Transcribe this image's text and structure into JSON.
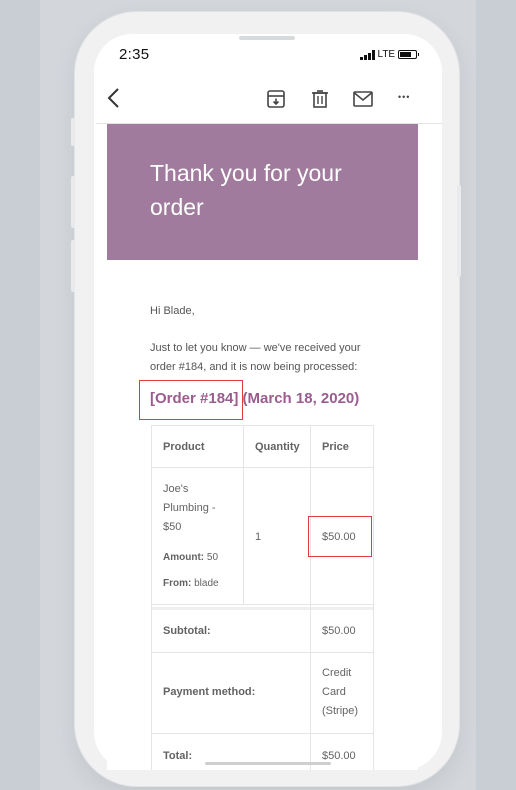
{
  "status_bar": {
    "time": "2:35",
    "network": "LTE",
    "battery_level": 0.7
  },
  "toolbar": {
    "back_icon": "chevron-left-icon",
    "archive_icon": "archive-icon",
    "delete_icon": "trash-icon",
    "mail_icon": "mail-icon",
    "more_label": "•••"
  },
  "email": {
    "hero_title": "Thank you for your order",
    "greeting": "Hi Blade,",
    "intro": "Just to let you know — we've received your order #184, and it is now being processed:",
    "order_number": "[Order #184]",
    "order_date": "(March 18, 2020)",
    "table": {
      "headers": {
        "product": "Product",
        "quantity": "Quantity",
        "price": "Price"
      },
      "item": {
        "name": "Joe's Plumbing - $50",
        "amount_label": "Amount:",
        "amount_value": "50",
        "from_label": "From:",
        "from_value": "blade",
        "quantity": "1",
        "price": "$50.00"
      },
      "subtotal_label": "Subtotal:",
      "subtotal_value": "$50.00",
      "payment_label": "Payment method:",
      "payment_value": "Credit Card (Stripe)",
      "total_label": "Total:",
      "total_value": "$50.00"
    }
  },
  "colors": {
    "hero_bg": "#a07b9d",
    "accent": "#9b5c8f",
    "highlight": "#e0393e"
  }
}
